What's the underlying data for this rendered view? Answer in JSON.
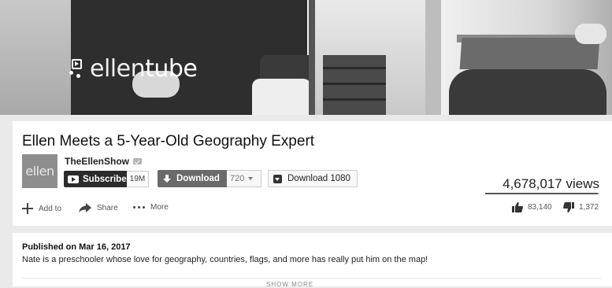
{
  "video": {
    "logo_text_a": "ellen",
    "logo_text_b": "tube",
    "logo_icon": "ellentube-logo-icon"
  },
  "info": {
    "title": "Ellen Meets a 5-Year-Old Geography Expert",
    "avatar_text": "ellen",
    "channel_name": "TheEllenShow",
    "subscribe_label": "Subscribe",
    "subscriber_count": "19M",
    "download_label": "Download",
    "download_quality": "720",
    "download_1080_label": "Download 1080",
    "views": "4,678,017 views",
    "like_ratio": 0.984,
    "actions": {
      "add_to": "Add to",
      "share": "Share",
      "more": "More"
    },
    "likes": "83,140",
    "dislikes": "1,372"
  },
  "description": {
    "published": "Published on Mar 16, 2017",
    "text": "Nate is a preschooler whose love for geography, countries, flags, and more has really put him on the map!",
    "show_more": "SHOW MORE"
  },
  "colors": {
    "page_bg": "#eaeaea",
    "card_bg": "#ffffff",
    "subscribe_bg": "#2b2b2b",
    "download_bg": "#6a6a6a"
  }
}
